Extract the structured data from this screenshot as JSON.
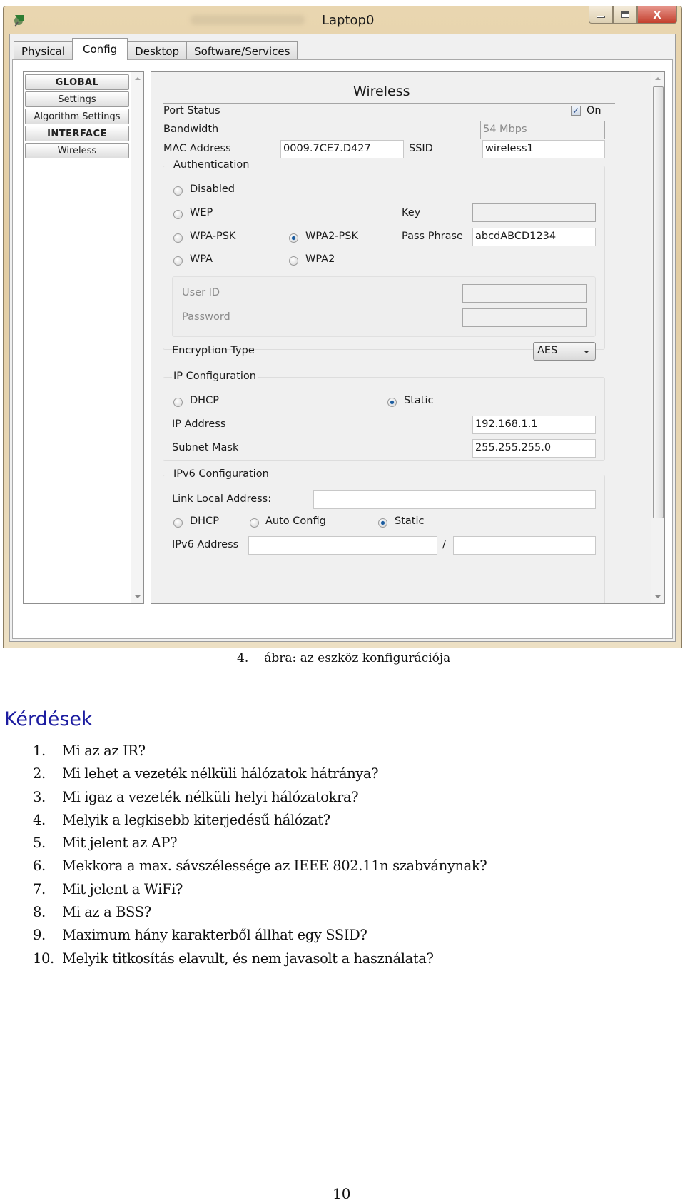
{
  "window": {
    "title": "Laptop0",
    "buttons": {
      "minimize": "—",
      "maximize": "▢",
      "close": "X"
    },
    "tabs": [
      {
        "label": "Physical",
        "active": false
      },
      {
        "label": "Config",
        "active": true
      },
      {
        "label": "Desktop",
        "active": false
      },
      {
        "label": "Software/Services",
        "active": false
      }
    ]
  },
  "sidebar": {
    "items": [
      {
        "label": "GLOBAL",
        "type": "header"
      },
      {
        "label": "Settings",
        "type": "item"
      },
      {
        "label": "Algorithm Settings",
        "type": "item"
      },
      {
        "label": "INTERFACE",
        "type": "header"
      },
      {
        "label": "Wireless",
        "type": "item"
      }
    ]
  },
  "wireless": {
    "heading": "Wireless",
    "port_status": {
      "label": "Port Status",
      "checkbox_label": "On",
      "checked": true
    },
    "bandwidth": {
      "label": "Bandwidth",
      "value": "54 Mbps"
    },
    "mac": {
      "label": "MAC Address",
      "value": "0009.7CE7.D427"
    },
    "ssid": {
      "label": "SSID",
      "value": "wireless1"
    },
    "authentication": {
      "title": "Authentication",
      "options": [
        {
          "label": "Disabled",
          "selected": false
        },
        {
          "label": "WEP",
          "selected": false
        },
        {
          "label": "WPA-PSK",
          "selected": false
        },
        {
          "label": "WPA2-PSK",
          "selected": true
        },
        {
          "label": "WPA",
          "selected": false
        },
        {
          "label": "WPA2",
          "selected": false
        }
      ],
      "key": {
        "label": "Key",
        "value": ""
      },
      "pass_phrase": {
        "label": "Pass Phrase",
        "value": "abcdABCD1234"
      },
      "user_id": {
        "label": "User ID",
        "value": ""
      },
      "password": {
        "label": "Password",
        "value": ""
      },
      "encryption": {
        "label": "Encryption Type",
        "value": "AES"
      }
    },
    "ip_config": {
      "title": "IP Configuration",
      "options": [
        {
          "label": "DHCP",
          "selected": false
        },
        {
          "label": "Static",
          "selected": true
        }
      ],
      "ip_address": {
        "label": "IP Address",
        "value": "192.168.1.1"
      },
      "subnet_mask": {
        "label": "Subnet Mask",
        "value": "255.255.255.0"
      }
    },
    "ipv6_config": {
      "title": "IPv6 Configuration",
      "link_local": {
        "label": "Link Local Address:",
        "value": ""
      },
      "options": [
        {
          "label": "DHCP",
          "selected": false
        },
        {
          "label": "Auto Config",
          "selected": false
        },
        {
          "label": "Static",
          "selected": true
        }
      ],
      "ipv6_address": {
        "label": "IPv6 Address",
        "value": "",
        "separator": "/",
        "prefix": ""
      }
    }
  },
  "document": {
    "caption_number": "4.",
    "caption_text": "ábra: az eszköz konfigurációja",
    "questions_title": "Kérdések",
    "questions": [
      {
        "num": "1.",
        "text": "Mi az az IR?"
      },
      {
        "num": "2.",
        "text": "Mi lehet a vezeték nélküli hálózatok hátránya?"
      },
      {
        "num": "3.",
        "text": "Mi igaz a vezeték nélküli helyi hálózatokra?"
      },
      {
        "num": "4.",
        "text": "Melyik a legkisebb kiterjedésű hálózat?"
      },
      {
        "num": "5.",
        "text": "Mit jelent az AP?"
      },
      {
        "num": "6.",
        "text": "Mekkora a max. sávszélessége az IEEE 802.11n szabványnak?"
      },
      {
        "num": "7.",
        "text": "Mit jelent a WiFi?"
      },
      {
        "num": "8.",
        "text": "Mi az a BSS?"
      },
      {
        "num": "9.",
        "text": "Maximum hány karakterből állhat egy SSID?"
      },
      {
        "num": "10.",
        "text": "Melyik titkosítás elavult, és nem javasolt a használata?"
      }
    ],
    "page_number": "10"
  }
}
